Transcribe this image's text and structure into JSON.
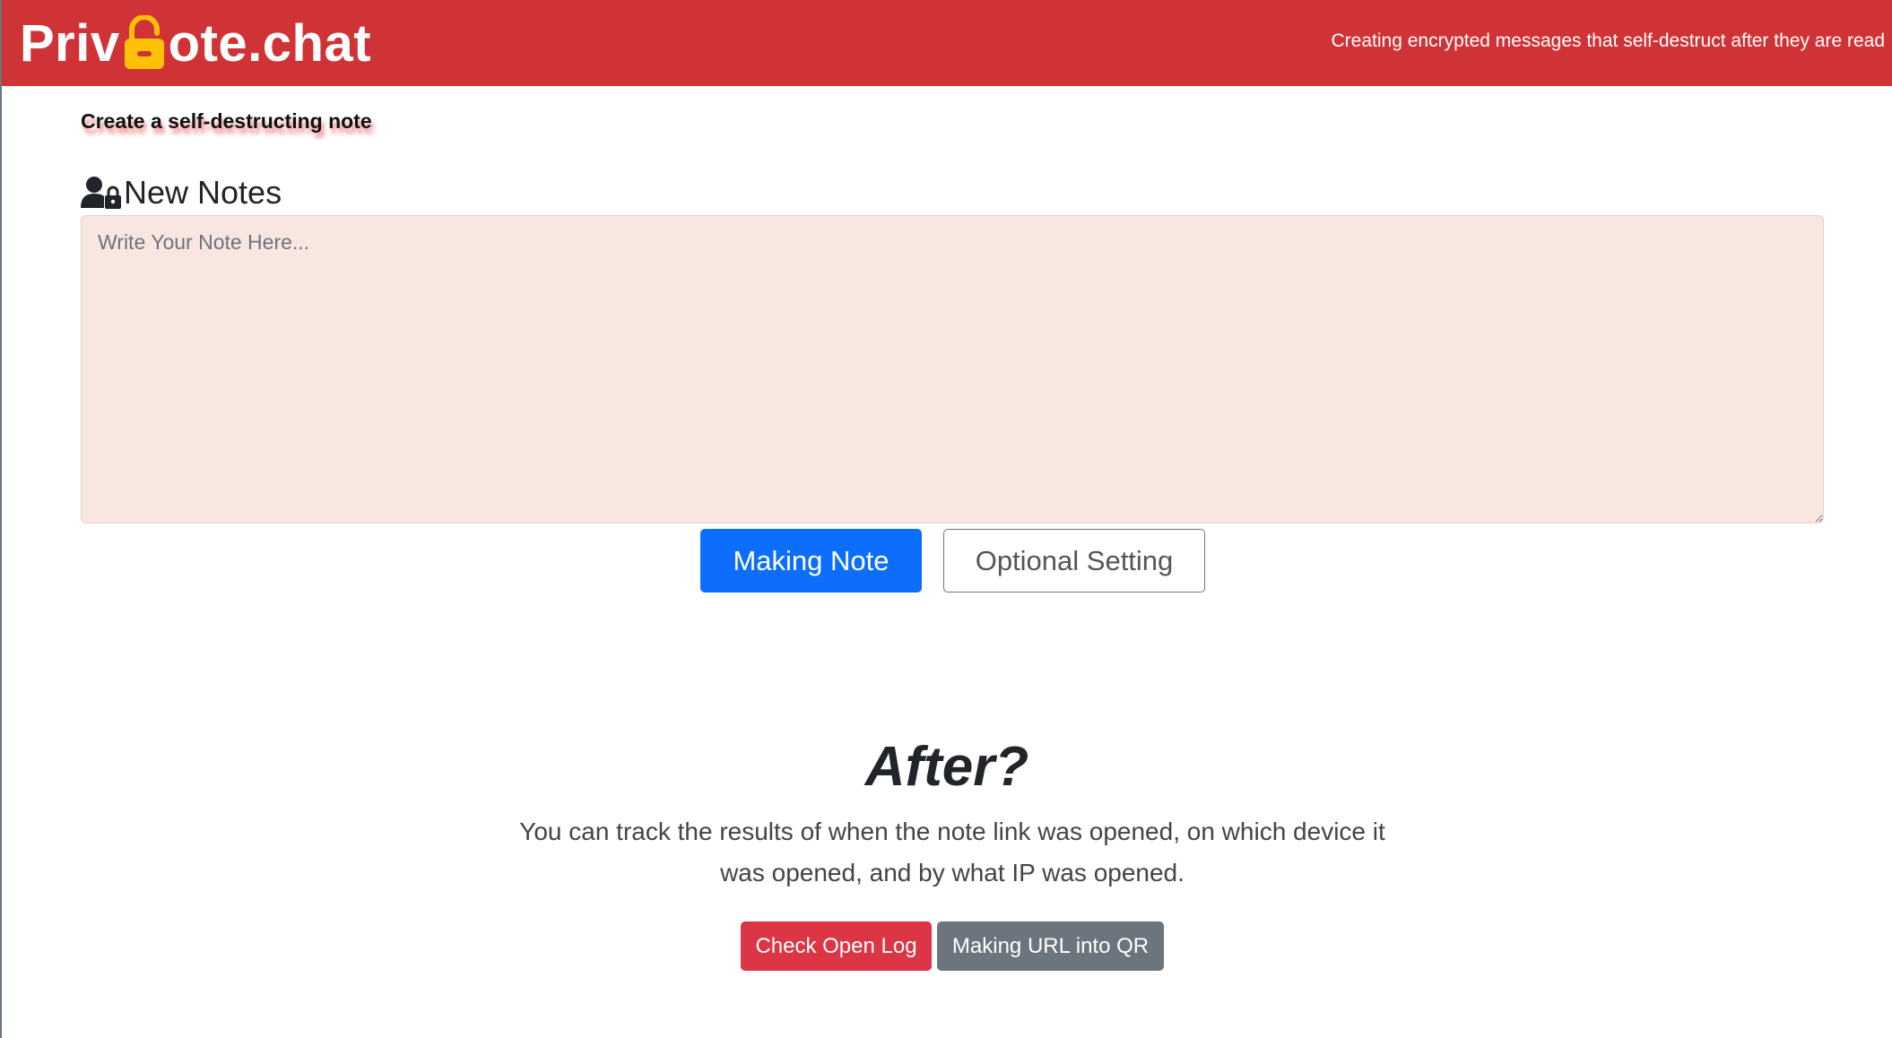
{
  "header": {
    "brand_left": "Priv",
    "brand_right": "ote.chat",
    "tagline": "Creating encrypted messages that self-destruct after they are read",
    "bg_color": "#cf3336"
  },
  "main": {
    "subtitle": "Create a self-destructing note",
    "section_label": "New Notes",
    "note_placeholder": "Write Your Note Here...",
    "note_value": "",
    "primary_button": "Making Note",
    "secondary_button": "Optional Setting"
  },
  "after": {
    "title": "After?",
    "description": "You can track the results of when the note link was opened, on which device it was opened, and by what IP was opened.",
    "log_button": "Check Open Log",
    "qr_button": "Making URL into QR"
  },
  "colors": {
    "primary": "#0d6efd",
    "danger": "#dc3545",
    "secondary": "#6c757d",
    "lock": "#ffc107",
    "note_bg": "#f8e6e0"
  },
  "icons": {
    "brand_lock": "open-padlock-icon",
    "section": "user-lock-icon"
  }
}
